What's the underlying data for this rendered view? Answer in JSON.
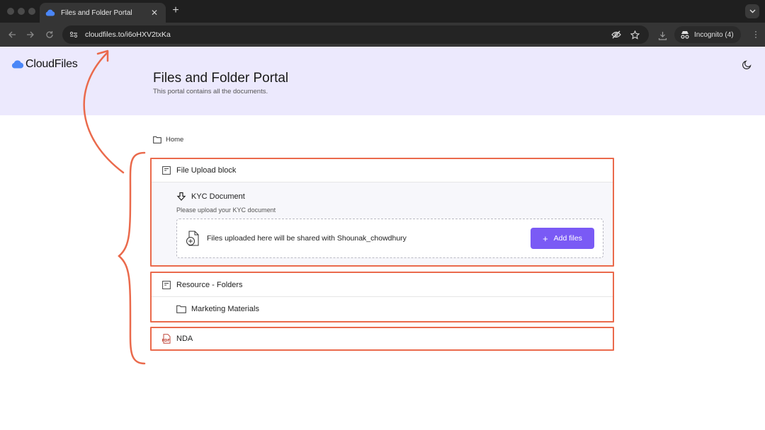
{
  "browser": {
    "tab_title": "Files and Folder Portal",
    "tab_close": "✕",
    "new_tab": "+",
    "url": "cloudfiles.to/i6oHXV2txKa",
    "incognito_label": "Incognito (4)",
    "icons": [
      "back-arrow-icon",
      "forward-arrow-icon",
      "reload-icon",
      "site-info-icon",
      "eye-off-icon",
      "star-icon",
      "download-icon",
      "incognito-icon",
      "menu-icon"
    ]
  },
  "header": {
    "logo_text": "CloudFiles",
    "title": "Files and Folder Portal",
    "subtitle": "This portal contains all the documents."
  },
  "breadcrumb": {
    "label": "Home"
  },
  "blocks": {
    "upload": {
      "title": "File Upload block",
      "item_title": "KYC Document",
      "item_subtitle": "Please upload your KYC document",
      "dropzone_text": "Files uploaded here will be shared with Shounak_chowdhury",
      "button_label": "Add files"
    },
    "resource": {
      "title": "Resource - Folders",
      "folder_label": "Marketing Materials"
    },
    "pdf": {
      "title": "NDA"
    }
  },
  "colors": {
    "accent": "#7a5af5",
    "hero_bg": "#ece9fd",
    "annotation": "#ea6a4c",
    "logo_blue": "#4a86f7"
  }
}
